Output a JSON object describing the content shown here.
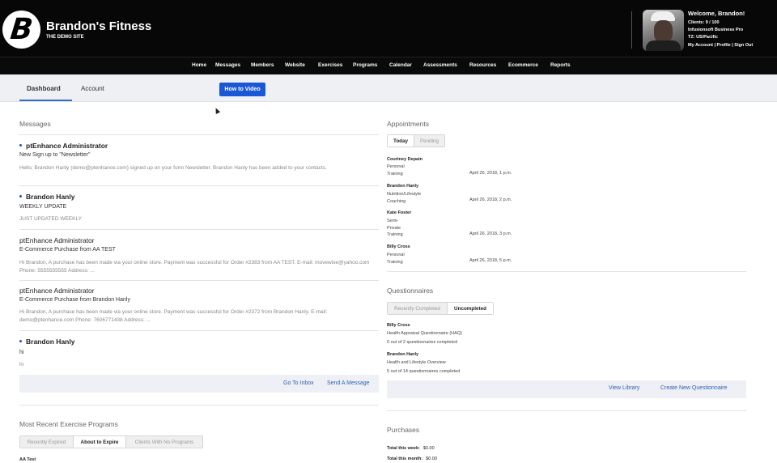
{
  "header": {
    "logo_letter": "B",
    "site_title": "Brandon's Fitness",
    "site_subtitle": "THE DEMO SITE",
    "welcome": "Welcome, Brandon!",
    "clients": "Clients: 9 / 100",
    "plan": "Infusionsoft Business Pro",
    "timezone": "TZ: US/Pacific",
    "links": "My Account | Profile | Sign Out"
  },
  "nav": {
    "items": [
      "Home",
      "Messages",
      "Members",
      "Website",
      "Exercises",
      "Programs",
      "Calendar",
      "Assessments",
      "Resources",
      "Ecommerce",
      "Reports"
    ]
  },
  "tabs": {
    "dashboard": "Dashboard",
    "account": "Account",
    "howto_button": "How to Video"
  },
  "messages": {
    "title": "Messages",
    "items": [
      {
        "sender": "ptEnhance Administrator",
        "subject": "New Sign up to \"Newsletter\"",
        "body": "Hello, Brandon Hanly (demo@ptenhance.com) signed up on your form Newsletter. Brandon Hanly has been added to your contacts."
      },
      {
        "sender": "Brandon Hanly",
        "subject": "WEEKLY UPDATE",
        "body": "JUST UPDATED WEEKLY"
      },
      {
        "sender": "ptEnhance Administrator",
        "subject": "E-Commerce Purchase from AA TEST",
        "body": "Hi Brandon, A purchase has been made via your online store. Payment was successful for Order #2383 from AA TEST. E-mail: movewise@yahoo.com Phone: 5555555555 Address: ..."
      },
      {
        "sender": "ptEnhance Administrator",
        "subject": "E-Commerce Purchase from Brandon Hanly",
        "body": "Hi Brandon, A purchase has been made via your online store. Payment was successful for Order #2372 from Brandon Hanly. E-mail: demo@ptenhance.com Phone: 7606771438 Address: ..."
      },
      {
        "sender": "Brandon Hanly",
        "subject": "hi",
        "body": "hi"
      }
    ],
    "go_to_inbox": "Go To Inbox",
    "send_message": "Send A Message"
  },
  "programs": {
    "title": "Most Recent Exercise Programs",
    "filters": [
      "Recently Expired",
      "About to Expire",
      "Clients With No Programs"
    ],
    "first_row": "AA Test"
  },
  "appointments": {
    "title": "Appointments",
    "filters": [
      "Today",
      "Pending"
    ],
    "items": [
      {
        "name": "Courtney Depain",
        "type": "Personal\nTraining",
        "date": "April 26, 2018, 1 p.m."
      },
      {
        "name": "Brandon Hanly",
        "type": "Nutrition/Lifestyle\nCoaching",
        "date": "April 26, 2018, 2 p.m."
      },
      {
        "name": "Kate Foster",
        "type": "Semi-\nPrivate\nTraining",
        "date": "April 26, 2018, 3 p.m."
      },
      {
        "name": "Billy Cross",
        "type": "Personal\nTraining",
        "date": "April 26, 2018, 5 p.m."
      }
    ]
  },
  "questionnaires": {
    "title": "Questionnaires",
    "filters": [
      "Recently Completed",
      "Uncompleted"
    ],
    "items": [
      {
        "name": "Billy Cross",
        "questionnaire": "Health Appraisal Questionnaire (HAQ)",
        "status": "0 out of 2 questionnaires completed"
      },
      {
        "name": "Brandon Hanly",
        "questionnaire": "Health and Lifestyle Overview",
        "status": "5 out of 14 questionnaires completed"
      }
    ],
    "view_library": "View Library",
    "create_new": "Create New Questionnaire"
  },
  "purchases": {
    "title": "Purchases",
    "week_label": "Total this week:",
    "week_value": "$0.00",
    "month_label": "Total this month:",
    "month_value": "$0.00"
  }
}
